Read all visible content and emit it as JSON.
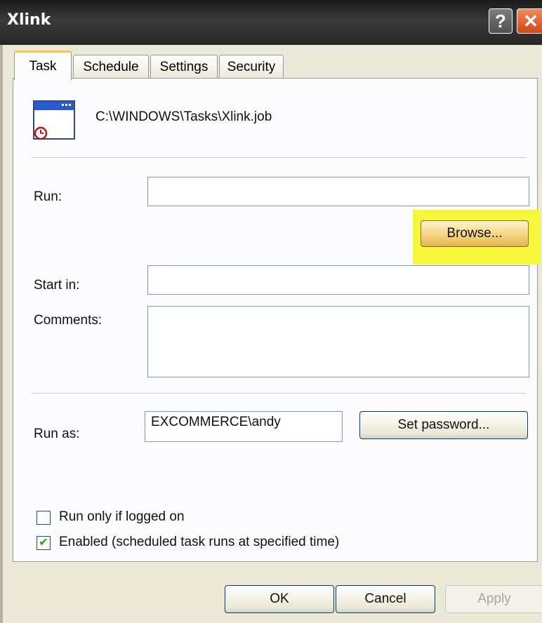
{
  "window": {
    "title": "Xlink",
    "help_glyph": "?",
    "close_glyph": "✕"
  },
  "tabs": [
    {
      "label": "Task",
      "active": true
    },
    {
      "label": "Schedule",
      "active": false
    },
    {
      "label": "Settings",
      "active": false
    },
    {
      "label": "Security",
      "active": false
    }
  ],
  "task": {
    "file_path": "C:\\WINDOWS\\Tasks\\Xlink.job",
    "run_label": "Run:",
    "run_value": "",
    "browse_label": "Browse...",
    "start_in_label": "Start in:",
    "start_in_value": "",
    "comments_label": "Comments:",
    "comments_value": "",
    "run_as_label": "Run as:",
    "run_as_value": "EXCOMMERCE\\andy",
    "set_password_label": "Set password...",
    "run_only_logged_on_label": "Run only if logged on",
    "run_only_logged_on_checked": false,
    "enabled_label": "Enabled (scheduled task runs at specified time)",
    "enabled_checked": true,
    "check_glyph": "✔"
  },
  "footer": {
    "ok_label": "OK",
    "cancel_label": "Cancel",
    "apply_label": "Apply"
  },
  "colors": {
    "highlight": "#f6f63a",
    "tab_accent": "#ffc83c",
    "dialog_bg": "#ece9d8"
  },
  "icons": {
    "task_file": "scheduled-task-window-icon"
  }
}
